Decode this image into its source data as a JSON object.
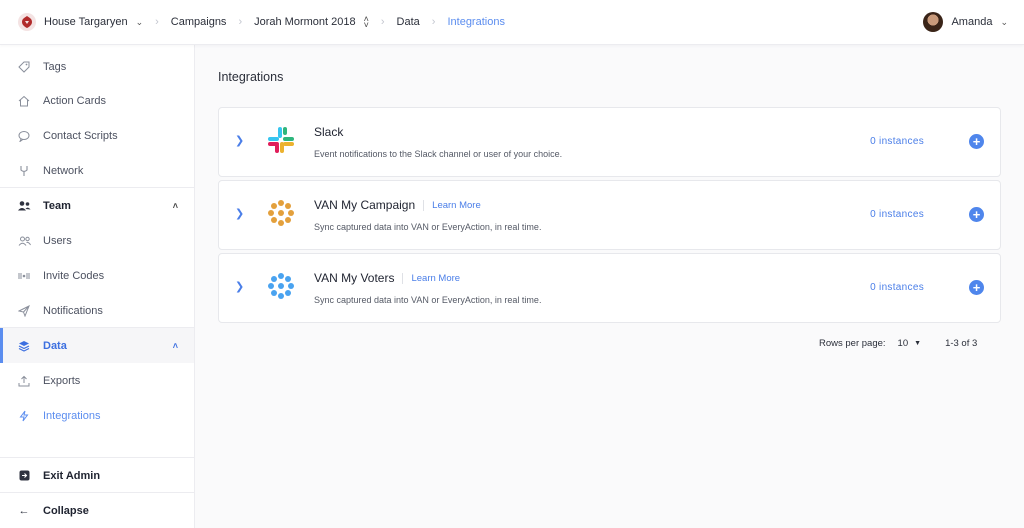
{
  "breadcrumb": {
    "org": "House Targaryen",
    "campaigns": "Campaigns",
    "campaign": "Jorah Mormont 2018",
    "data": "Data",
    "current": "Integrations"
  },
  "user": {
    "name": "Amanda"
  },
  "sidebar": {
    "items": [
      {
        "label": "Tags",
        "icon": "tag-icon"
      },
      {
        "label": "Action Cards",
        "icon": "home-icon"
      },
      {
        "label": "Contact Scripts",
        "icon": "chat-icon"
      },
      {
        "label": "Network",
        "icon": "network-icon"
      },
      {
        "label": "Team",
        "icon": "team-icon"
      },
      {
        "label": "Users",
        "icon": "users-icon"
      },
      {
        "label": "Invite Codes",
        "icon": "invite-icon"
      },
      {
        "label": "Notifications",
        "icon": "send-icon"
      },
      {
        "label": "Data",
        "icon": "layers-icon"
      },
      {
        "label": "Exports",
        "icon": "upload-icon"
      },
      {
        "label": "Integrations",
        "icon": "bolt-icon"
      }
    ],
    "exit_admin": "Exit Admin",
    "collapse": "Collapse"
  },
  "main": {
    "title": "Integrations",
    "integrations": [
      {
        "name": "Slack",
        "learn_more": "",
        "description": "Event notifications to the Slack channel or user of your choice.",
        "instances": "0 instances"
      },
      {
        "name": "VAN My Campaign",
        "learn_more": "Learn More",
        "description": "Sync captured data into VAN or EveryAction, in real time.",
        "instances": "0 instances"
      },
      {
        "name": "VAN My Voters",
        "learn_more": "Learn More",
        "description": "Sync captured data into VAN or EveryAction, in real time.",
        "instances": "0 instances"
      }
    ],
    "pagination": {
      "rows_label": "Rows per page:",
      "rows_value": "10",
      "range": "1-3 of 3"
    }
  },
  "colors": {
    "accent": "#5b8def",
    "van_campaign": "#e3a03c",
    "van_voters": "#4aa3f0"
  }
}
